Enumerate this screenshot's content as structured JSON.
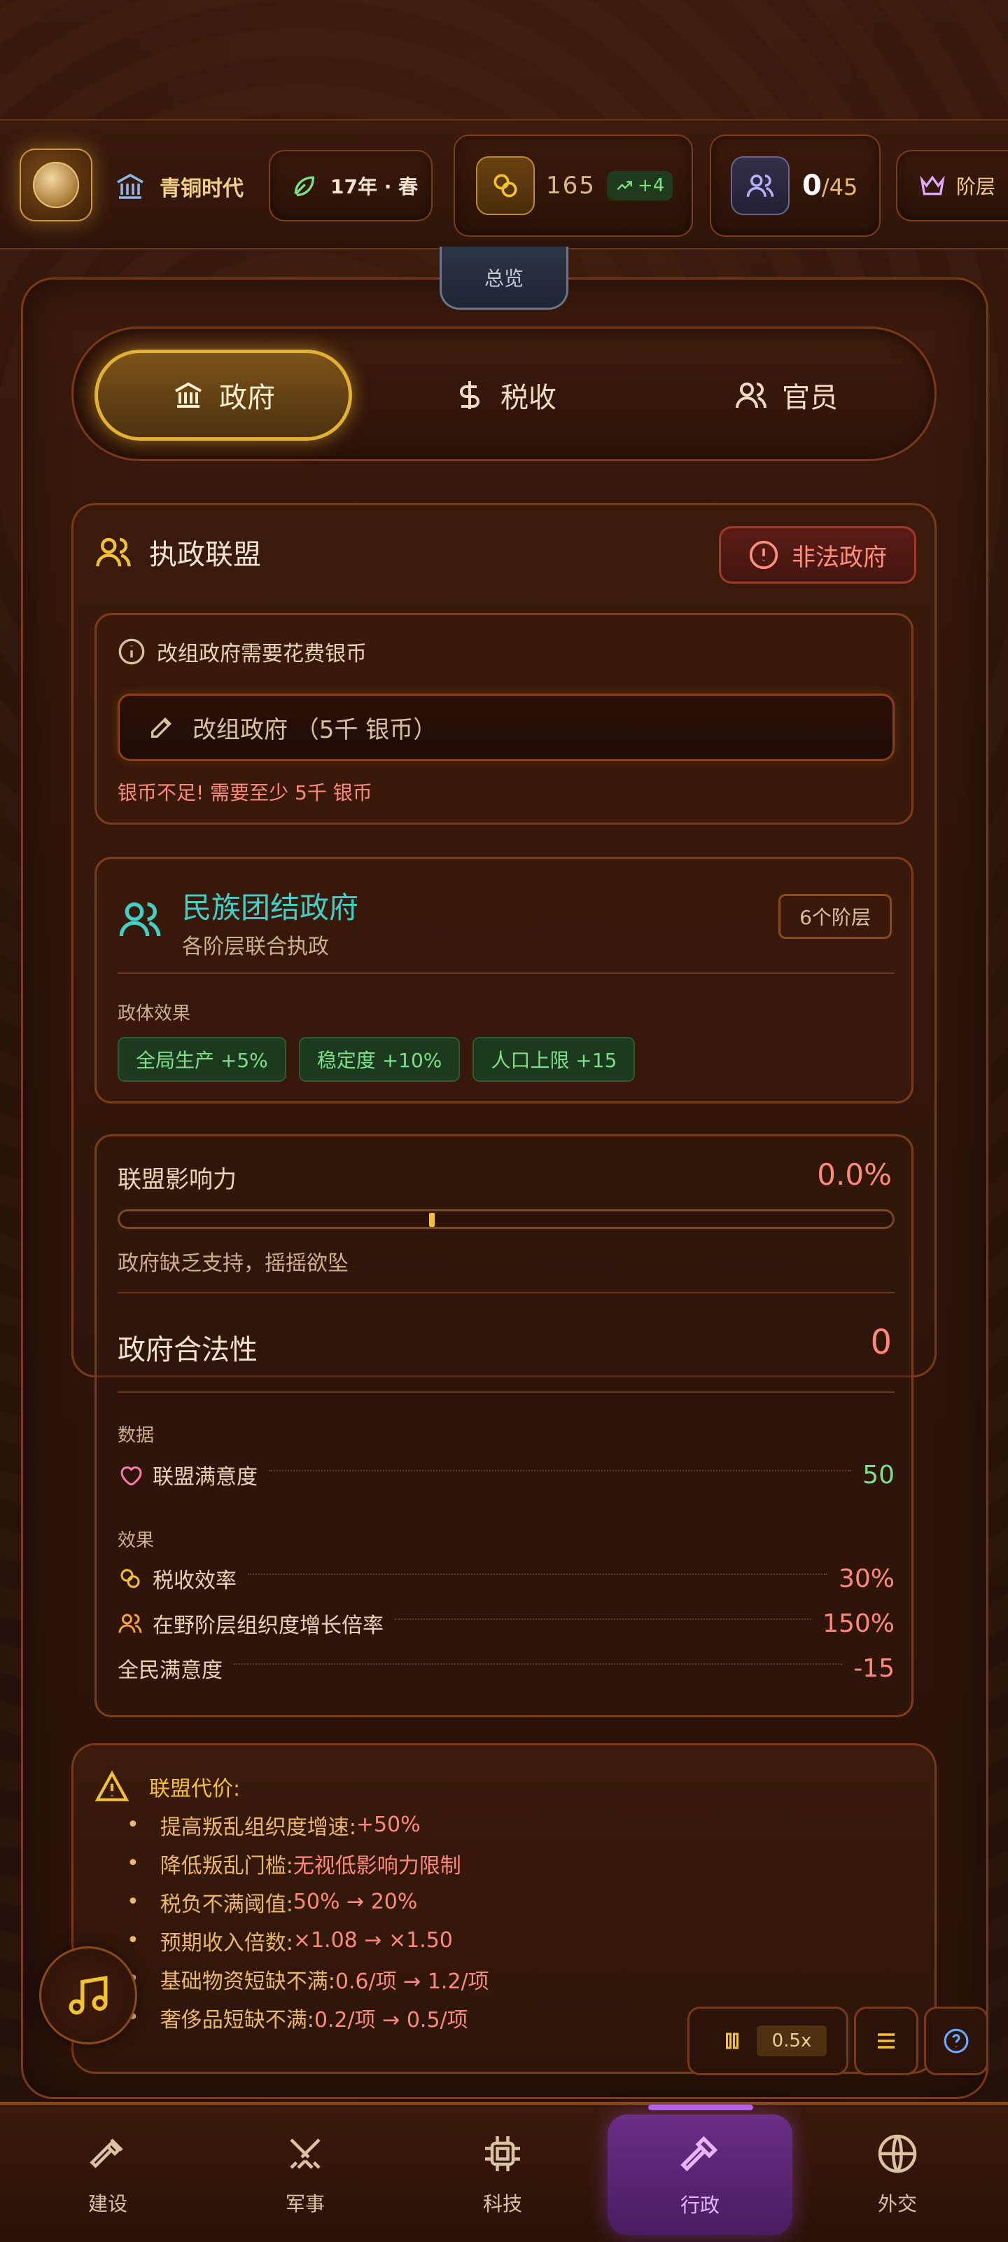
{
  "topbar": {
    "era": "青铜时代",
    "year": "17年 · 春",
    "silver": "165",
    "silver_rate": "+4",
    "pop_current": "0",
    "pop_max": "/45",
    "class_label": "阶层"
  },
  "overview_tab": "总览",
  "tabs": [
    {
      "label": "政府",
      "icon": "bank-icon",
      "active": true
    },
    {
      "label": "税收",
      "icon": "dollar-icon",
      "active": false
    },
    {
      "label": "官员",
      "icon": "users-icon",
      "active": false
    }
  ],
  "coalition": {
    "title": "执政联盟",
    "status_badge": "非法政府",
    "reorg_info": "改组政府需要花费银币",
    "reorg_button": "改组政府 （5千 银币）",
    "reorg_error": "银币不足! 需要至少 5千 银币"
  },
  "government": {
    "name": "民族团结政府",
    "subtitle": "各阶层联合执政",
    "class_count": "6个阶层",
    "effects_label": "政体效果",
    "effects": [
      "全局生产 +5%",
      "稳定度 +10%",
      "人口上限 +15"
    ]
  },
  "influence": {
    "label": "联盟影响力",
    "value": "0.0%",
    "bar_fraction": 0.4,
    "note": "政府缺乏支持，摇摇欲坠",
    "legitimacy_label": "政府合法性",
    "legitimacy_value": "0",
    "data_label": "数据",
    "satisfaction_label": "联盟满意度",
    "satisfaction_value": "50",
    "effects_label": "效果",
    "tax_eff_label": "税收效率",
    "tax_eff_value": "30%",
    "org_label": "在野阶层组织度增长倍率",
    "org_value": "150%",
    "public_label": "全民满意度",
    "public_value": "-15"
  },
  "cost": {
    "title": "联盟代价:",
    "items": [
      {
        "label": "提高叛乱组织度增速: ",
        "value": "+50%"
      },
      {
        "label": "降低叛乱门槛: ",
        "value": "无视低影响力限制"
      },
      {
        "label": "税负不满阈值: ",
        "value": "50% → 20%"
      },
      {
        "label": "预期收入倍数: ",
        "value": "×1.08 → ×1.50"
      },
      {
        "label": "基础物资短缺不满: ",
        "value": "0.6/项 → 1.2/项"
      },
      {
        "label": "奢侈品短缺不满: ",
        "value": "0.2/项 → 0.5/项"
      }
    ]
  },
  "speed": "0.5x",
  "nav": [
    {
      "label": "建设",
      "icon": "hammer-icon"
    },
    {
      "label": "军事",
      "icon": "swords-icon"
    },
    {
      "label": "科技",
      "icon": "chip-icon"
    },
    {
      "label": "行政",
      "icon": "gavel-icon",
      "active": true
    },
    {
      "label": "外交",
      "icon": "globe-icon"
    }
  ],
  "colors": {
    "accent": "#e2b032",
    "danger": "#ff8a7a",
    "positive": "#7ee08a",
    "nav_active": "#6a2e86"
  }
}
